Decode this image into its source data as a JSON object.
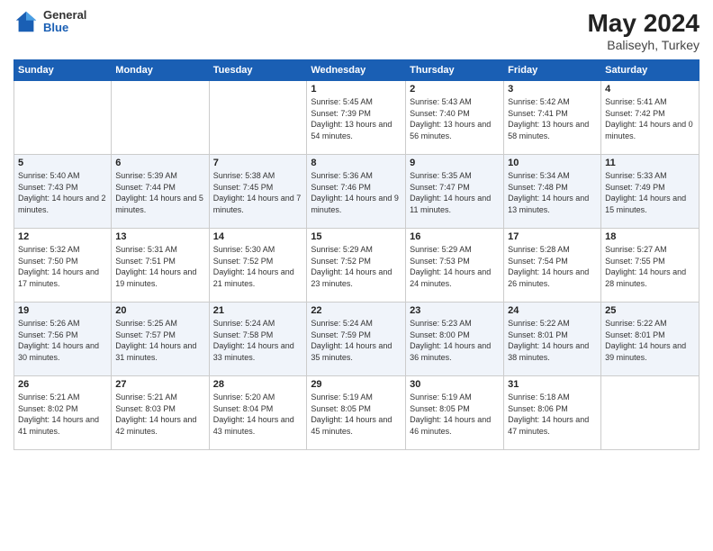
{
  "header": {
    "logo_general": "General",
    "logo_blue": "Blue",
    "month_year": "May 2024",
    "location": "Baliseyh, Turkey"
  },
  "days_of_week": [
    "Sunday",
    "Monday",
    "Tuesday",
    "Wednesday",
    "Thursday",
    "Friday",
    "Saturday"
  ],
  "weeks": [
    [
      {
        "day": "",
        "sunrise": "",
        "sunset": "",
        "daylight": ""
      },
      {
        "day": "",
        "sunrise": "",
        "sunset": "",
        "daylight": ""
      },
      {
        "day": "",
        "sunrise": "",
        "sunset": "",
        "daylight": ""
      },
      {
        "day": "1",
        "sunrise": "Sunrise: 5:45 AM",
        "sunset": "Sunset: 7:39 PM",
        "daylight": "Daylight: 13 hours and 54 minutes."
      },
      {
        "day": "2",
        "sunrise": "Sunrise: 5:43 AM",
        "sunset": "Sunset: 7:40 PM",
        "daylight": "Daylight: 13 hours and 56 minutes."
      },
      {
        "day": "3",
        "sunrise": "Sunrise: 5:42 AM",
        "sunset": "Sunset: 7:41 PM",
        "daylight": "Daylight: 13 hours and 58 minutes."
      },
      {
        "day": "4",
        "sunrise": "Sunrise: 5:41 AM",
        "sunset": "Sunset: 7:42 PM",
        "daylight": "Daylight: 14 hours and 0 minutes."
      }
    ],
    [
      {
        "day": "5",
        "sunrise": "Sunrise: 5:40 AM",
        "sunset": "Sunset: 7:43 PM",
        "daylight": "Daylight: 14 hours and 2 minutes."
      },
      {
        "day": "6",
        "sunrise": "Sunrise: 5:39 AM",
        "sunset": "Sunset: 7:44 PM",
        "daylight": "Daylight: 14 hours and 5 minutes."
      },
      {
        "day": "7",
        "sunrise": "Sunrise: 5:38 AM",
        "sunset": "Sunset: 7:45 PM",
        "daylight": "Daylight: 14 hours and 7 minutes."
      },
      {
        "day": "8",
        "sunrise": "Sunrise: 5:36 AM",
        "sunset": "Sunset: 7:46 PM",
        "daylight": "Daylight: 14 hours and 9 minutes."
      },
      {
        "day": "9",
        "sunrise": "Sunrise: 5:35 AM",
        "sunset": "Sunset: 7:47 PM",
        "daylight": "Daylight: 14 hours and 11 minutes."
      },
      {
        "day": "10",
        "sunrise": "Sunrise: 5:34 AM",
        "sunset": "Sunset: 7:48 PM",
        "daylight": "Daylight: 14 hours and 13 minutes."
      },
      {
        "day": "11",
        "sunrise": "Sunrise: 5:33 AM",
        "sunset": "Sunset: 7:49 PM",
        "daylight": "Daylight: 14 hours and 15 minutes."
      }
    ],
    [
      {
        "day": "12",
        "sunrise": "Sunrise: 5:32 AM",
        "sunset": "Sunset: 7:50 PM",
        "daylight": "Daylight: 14 hours and 17 minutes."
      },
      {
        "day": "13",
        "sunrise": "Sunrise: 5:31 AM",
        "sunset": "Sunset: 7:51 PM",
        "daylight": "Daylight: 14 hours and 19 minutes."
      },
      {
        "day": "14",
        "sunrise": "Sunrise: 5:30 AM",
        "sunset": "Sunset: 7:52 PM",
        "daylight": "Daylight: 14 hours and 21 minutes."
      },
      {
        "day": "15",
        "sunrise": "Sunrise: 5:29 AM",
        "sunset": "Sunset: 7:52 PM",
        "daylight": "Daylight: 14 hours and 23 minutes."
      },
      {
        "day": "16",
        "sunrise": "Sunrise: 5:29 AM",
        "sunset": "Sunset: 7:53 PM",
        "daylight": "Daylight: 14 hours and 24 minutes."
      },
      {
        "day": "17",
        "sunrise": "Sunrise: 5:28 AM",
        "sunset": "Sunset: 7:54 PM",
        "daylight": "Daylight: 14 hours and 26 minutes."
      },
      {
        "day": "18",
        "sunrise": "Sunrise: 5:27 AM",
        "sunset": "Sunset: 7:55 PM",
        "daylight": "Daylight: 14 hours and 28 minutes."
      }
    ],
    [
      {
        "day": "19",
        "sunrise": "Sunrise: 5:26 AM",
        "sunset": "Sunset: 7:56 PM",
        "daylight": "Daylight: 14 hours and 30 minutes."
      },
      {
        "day": "20",
        "sunrise": "Sunrise: 5:25 AM",
        "sunset": "Sunset: 7:57 PM",
        "daylight": "Daylight: 14 hours and 31 minutes."
      },
      {
        "day": "21",
        "sunrise": "Sunrise: 5:24 AM",
        "sunset": "Sunset: 7:58 PM",
        "daylight": "Daylight: 14 hours and 33 minutes."
      },
      {
        "day": "22",
        "sunrise": "Sunrise: 5:24 AM",
        "sunset": "Sunset: 7:59 PM",
        "daylight": "Daylight: 14 hours and 35 minutes."
      },
      {
        "day": "23",
        "sunrise": "Sunrise: 5:23 AM",
        "sunset": "Sunset: 8:00 PM",
        "daylight": "Daylight: 14 hours and 36 minutes."
      },
      {
        "day": "24",
        "sunrise": "Sunrise: 5:22 AM",
        "sunset": "Sunset: 8:01 PM",
        "daylight": "Daylight: 14 hours and 38 minutes."
      },
      {
        "day": "25",
        "sunrise": "Sunrise: 5:22 AM",
        "sunset": "Sunset: 8:01 PM",
        "daylight": "Daylight: 14 hours and 39 minutes."
      }
    ],
    [
      {
        "day": "26",
        "sunrise": "Sunrise: 5:21 AM",
        "sunset": "Sunset: 8:02 PM",
        "daylight": "Daylight: 14 hours and 41 minutes."
      },
      {
        "day": "27",
        "sunrise": "Sunrise: 5:21 AM",
        "sunset": "Sunset: 8:03 PM",
        "daylight": "Daylight: 14 hours and 42 minutes."
      },
      {
        "day": "28",
        "sunrise": "Sunrise: 5:20 AM",
        "sunset": "Sunset: 8:04 PM",
        "daylight": "Daylight: 14 hours and 43 minutes."
      },
      {
        "day": "29",
        "sunrise": "Sunrise: 5:19 AM",
        "sunset": "Sunset: 8:05 PM",
        "daylight": "Daylight: 14 hours and 45 minutes."
      },
      {
        "day": "30",
        "sunrise": "Sunrise: 5:19 AM",
        "sunset": "Sunset: 8:05 PM",
        "daylight": "Daylight: 14 hours and 46 minutes."
      },
      {
        "day": "31",
        "sunrise": "Sunrise: 5:18 AM",
        "sunset": "Sunset: 8:06 PM",
        "daylight": "Daylight: 14 hours and 47 minutes."
      },
      {
        "day": "",
        "sunrise": "",
        "sunset": "",
        "daylight": ""
      }
    ]
  ]
}
